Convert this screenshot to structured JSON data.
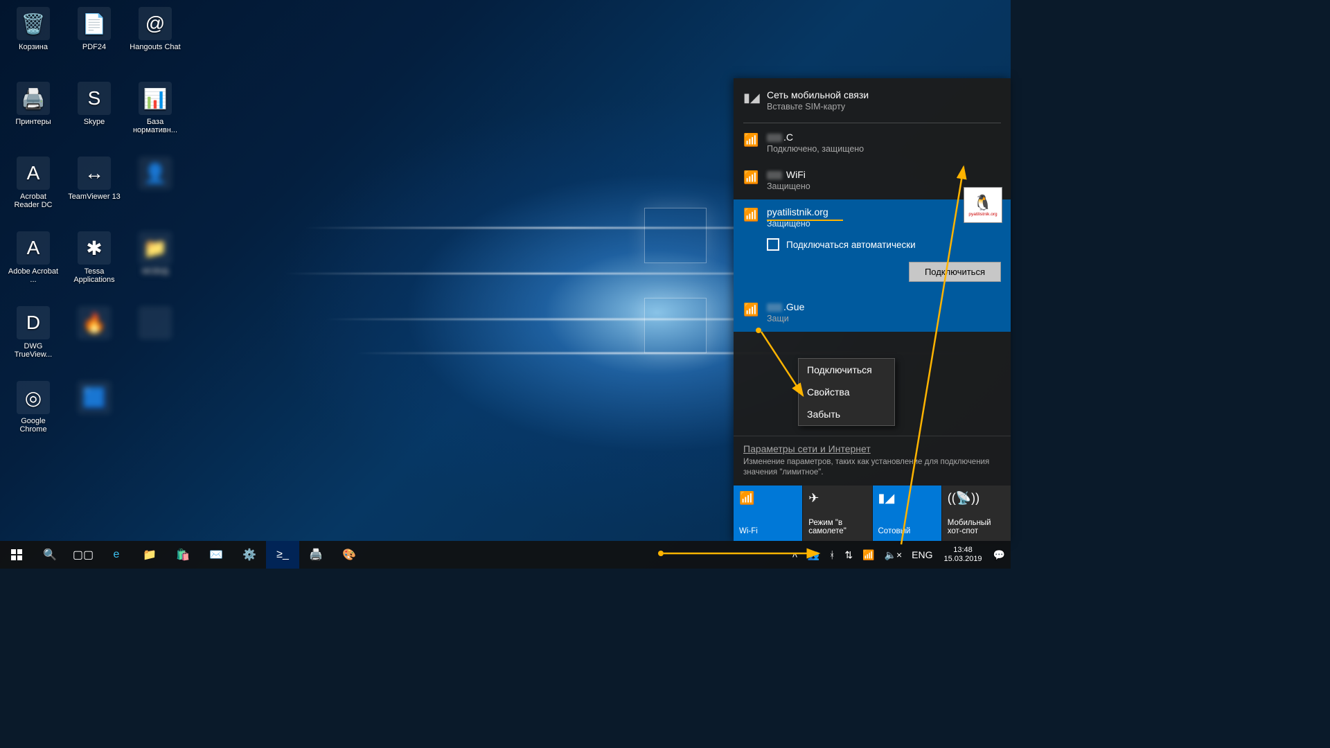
{
  "desktop_icons": [
    {
      "label": "Корзина",
      "glyph": "🗑️"
    },
    {
      "label": "PDF24",
      "glyph": "📄"
    },
    {
      "label": "Hangouts Chat",
      "glyph": "@"
    },
    {
      "label": "Принтеры",
      "glyph": "🖨️"
    },
    {
      "label": "Skype",
      "glyph": "S"
    },
    {
      "label": "База нормативн...",
      "glyph": "📊"
    },
    {
      "label": "Acrobat Reader DC",
      "glyph": "A"
    },
    {
      "label": "TeamViewer 13",
      "glyph": "↔"
    },
    {
      "label": "",
      "glyph": "👤",
      "blur": true
    },
    {
      "label": "Adobe Acrobat ...",
      "glyph": "A"
    },
    {
      "label": "Tessa Applications",
      "glyph": "✱"
    },
    {
      "label": "МСВУД",
      "glyph": "📁",
      "blur": true
    },
    {
      "label": "DWG TrueView...",
      "glyph": "D"
    },
    {
      "label": "",
      "glyph": "🔥",
      "blur": true
    },
    {
      "label": "",
      "glyph": "",
      "blur": true
    },
    {
      "label": "Google Chrome",
      "glyph": "◎"
    },
    {
      "label": "",
      "glyph": "🟦",
      "blur": true
    }
  ],
  "network": {
    "cellular": {
      "title": "Сеть мобильной связи",
      "sub": "Вставьте SIM-карту"
    },
    "items": [
      {
        "name": ".C",
        "sub": "Подключено, защищено",
        "blur_prefix": true
      },
      {
        "name": " WiFi",
        "sub": "Защищено",
        "blur_prefix": true
      },
      {
        "name": "pyatilistnik.org",
        "sub": "Защищено",
        "selected": true
      },
      {
        "name": ".Gue",
        "sub": "Защи",
        "blur_prefix": true
      }
    ],
    "auto_connect_label": "Подключаться автоматически",
    "connect_button": "Подключиться",
    "settings_link": "Параметры сети и Интернет",
    "settings_desc": "Изменение параметров, таких как установление для подключения значения \"лимитное\".",
    "tiles": [
      {
        "label": "Wi-Fi",
        "active": true
      },
      {
        "label": "Режим \"в самолете\""
      },
      {
        "label": "Сотовый",
        "active": true
      },
      {
        "label": "Мобильный хот-спот"
      }
    ]
  },
  "context_menu": {
    "items": [
      "Подключиться",
      "Свойства",
      "Забыть"
    ]
  },
  "tray": {
    "lang": "ENG",
    "time": "13:48",
    "date": "15.03.2019"
  },
  "logo": {
    "text": "pyatilistnik.org"
  },
  "colors": {
    "accent": "#0078d7",
    "selected": "#005a9e",
    "arrow": "#ffb400"
  }
}
